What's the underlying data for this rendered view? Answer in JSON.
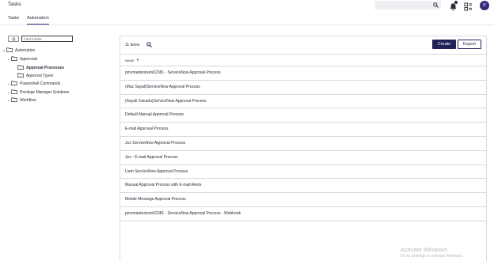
{
  "app": {
    "title": "Tasks"
  },
  "header": {
    "search_icon": "search-icon",
    "notification_icon": "bell-icon",
    "apps_icon": "grid-icon",
    "avatar_initial": "P",
    "accent": "#3a2a7a"
  },
  "tabs": [
    {
      "label": "Tasks",
      "active": false
    },
    {
      "label": "Automation",
      "active": true
    }
  ],
  "tree": {
    "refresh_icon": "refresh-icon",
    "find_placeholder": "Find Folder",
    "items": [
      {
        "label": "Automation",
        "expanded": true,
        "bold": false
      },
      {
        "label": "Approvals",
        "expanded": true,
        "bold": false
      },
      {
        "label": "Approval Processes",
        "expanded": false,
        "bold": true
      },
      {
        "label": "Approval Types",
        "expanded": false,
        "bold": false
      },
      {
        "label": "Powershell Commands",
        "expanded": false,
        "bold": false
      },
      {
        "label": "Privilege Manager Solutions",
        "expanded": false,
        "bold": false
      },
      {
        "label": "Workflow",
        "expanded": false,
        "bold": false
      }
    ]
  },
  "panel": {
    "count_label": "11 items",
    "create_label": "Create",
    "export_label": "Export",
    "column_name": "NAME",
    "sort_indicator": "▼",
    "primary_color": "#22215a",
    "rows": [
      "pmvmantestven02381 - ServiceNow Approval Process",
      "(Mac Sayali)ServiceNow Approval Process",
      "(Sayali Xanadu)ServiceNow Approval Process",
      "Default Manual Approval Process",
      "E-mail Approval Process",
      "Jez ServiceNow Approval Process",
      "Jez - E-mail Approval Process",
      "Liam ServiceNow Approval Process",
      "Manual Approval Process with E-mail Alerts",
      "Mobile Message Approval Process",
      "pmvmantestven02381 - ServiceNow Approval Process - Webhook"
    ]
  },
  "watermark": {
    "line1": "Activate Windows",
    "line2": "Go to Settings to activate Windows."
  }
}
